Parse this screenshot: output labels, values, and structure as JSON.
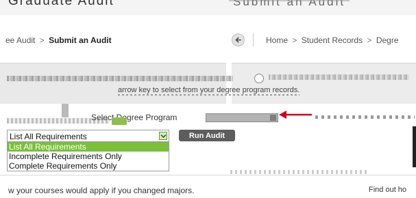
{
  "banner": {
    "left_text": "Graduate Audit",
    "right_text": "Submit an Audit"
  },
  "breadcrumb_left": {
    "parent": "ee Audit",
    "separator": ">",
    "current": "Submit an Audit"
  },
  "breadcrumb_right": {
    "home": "Home",
    "separator": ">",
    "section": "Student Records",
    "sub": "Degre"
  },
  "tip": {
    "text": "arrow key to select from your degree program records."
  },
  "program_select": {
    "label": "Select Degree Program"
  },
  "audit_type": {
    "selected": "List All Requirements",
    "options": [
      "List All Requirements",
      "Incomplete Requirements Only",
      "Complete Requirements Only"
    ],
    "highlighted_index": 0
  },
  "run_button": {
    "label": "Run Audit"
  },
  "bottom": {
    "left_text": "w your courses would apply if you changed majors.",
    "right_text": "Find out ho"
  },
  "colors": {
    "accent_green": "#7cbf3a",
    "button_grey": "#5d5d5d",
    "arrow_red": "#d0021b"
  }
}
